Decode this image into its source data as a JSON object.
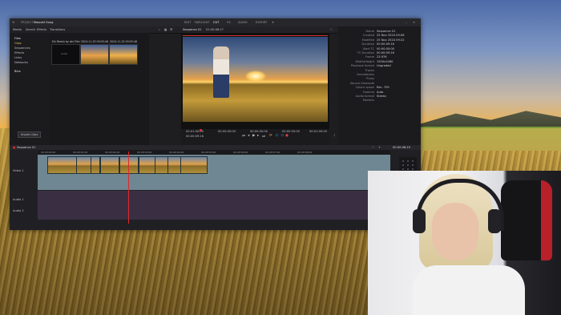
{
  "window": {
    "app_name": "PROJECT",
    "project_title": "Mascott Song",
    "nav_tabs": [
      "EDIT",
      "FAIRLIGHT",
      "CUT",
      "FX",
      "AUDIO",
      "EXPORT"
    ],
    "active_tab": "CUT"
  },
  "subbar": {
    "items": [
      "Media",
      "Search",
      "Effects",
      "Transitions"
    ],
    "view_tabs": [
      "All clips",
      "",
      "Text / Audio"
    ],
    "viewer_label": "Sequence 01",
    "viewer_timecode": "01:00:08:17",
    "inspector_tabs": [
      "Information",
      "Transform",
      "Effects",
      "Audio"
    ]
  },
  "sidebar": {
    "items": [
      "Files",
      "Clips",
      "Sequences",
      "Effects",
      "Links",
      "Networks",
      "Bins"
    ]
  },
  "media": {
    "clips": [
      {
        "label": "Ein Remix by der Film"
      },
      {
        "label": "2024-11-25 09:05:46"
      },
      {
        "label": "2024-11-25 09:05:48"
      }
    ],
    "import_button": "Import clips"
  },
  "viewer": {
    "timecodes": [
      "00:01:00:00",
      "00:00:45:00",
      "00:00:50:00",
      "00:00:55:00",
      "00:01:00:00"
    ],
    "current_timecode": "00:00:09:16"
  },
  "inspector": {
    "rows": [
      {
        "k": "Name",
        "v": "Sequence 01"
      },
      {
        "k": "Created",
        "v": "25 Nov 2024 09:08"
      },
      {
        "k": "Modified",
        "v": "25 Nov 2024 09:22"
      },
      {
        "k": "Duration",
        "v": "00:00:09:16"
      },
      {
        "k": "Start TC",
        "v": "00:00:00:00"
      },
      {
        "k": "TC Duration",
        "v": "00:00:09:16"
      },
      {
        "k": "Frame",
        "v": "23.976"
      },
      {
        "k": "Width/Height",
        "v": "1920x1080"
      },
      {
        "k": "Playback format",
        "v": "Ungraded"
      },
      {
        "k": "Tracks",
        "v": ""
      },
      {
        "k": "Annotations",
        "v": ""
      },
      {
        "k": "Proxy",
        "v": ""
      },
      {
        "k": "Source timecode",
        "v": ""
      },
      {
        "k": "Colour space",
        "v": "Rec. 709"
      },
      {
        "k": "Gamma",
        "v": "Auto"
      },
      {
        "k": "Audio format",
        "v": "Stereo"
      },
      {
        "k": "Markers",
        "v": ""
      }
    ]
  },
  "timeline": {
    "sequence_label": "Sequence 01",
    "timecode": "00:00:06:19",
    "ruler": [
      "00:00:00:00",
      "00:00:01:00",
      "00:00:02:00",
      "00:00:03:00",
      "00:00:04:00",
      "00:00:05:00",
      "00:00:06:00",
      "00:00:07:00",
      "00:00:08:00"
    ],
    "video_track": "Video 1",
    "audio_tracks": [
      "Audio 1",
      "Audio 2"
    ],
    "clip_count": 9
  }
}
